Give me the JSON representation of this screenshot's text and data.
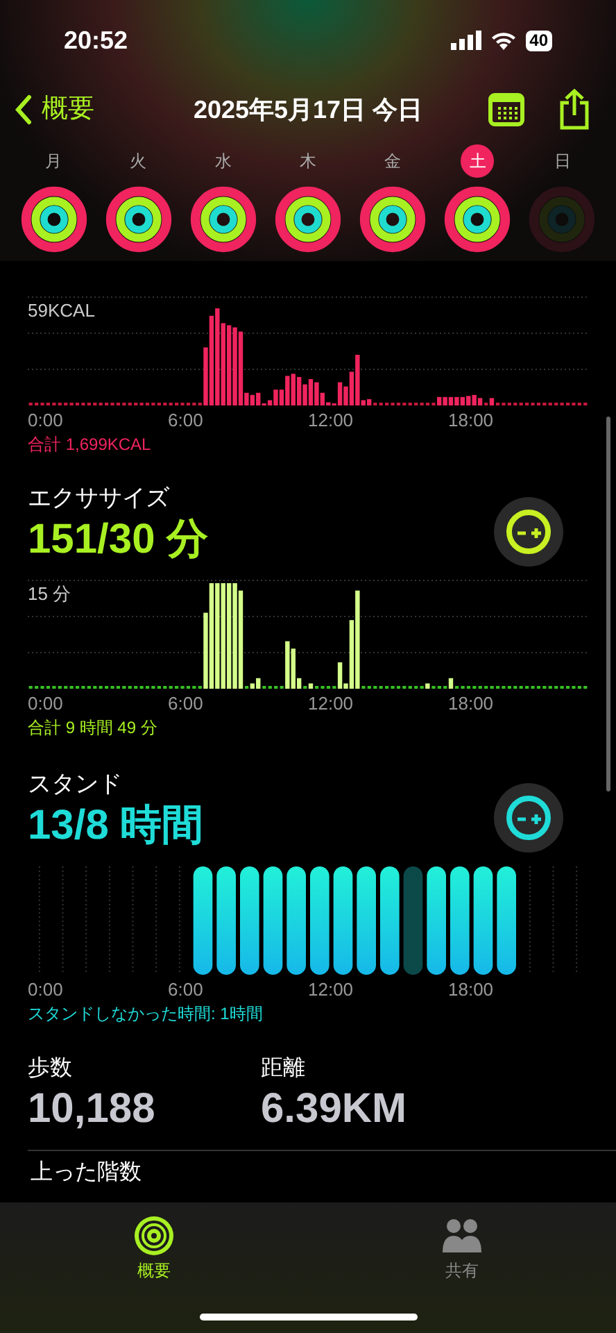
{
  "status_bar": {
    "time": "20:52",
    "battery": "40"
  },
  "nav": {
    "back": "概要",
    "title": "2025年5月17日 今日"
  },
  "week": [
    {
      "label": "月",
      "selected": false,
      "dimmed": false
    },
    {
      "label": "火",
      "selected": false,
      "dimmed": false
    },
    {
      "label": "水",
      "selected": false,
      "dimmed": false
    },
    {
      "label": "木",
      "selected": false,
      "dimmed": false
    },
    {
      "label": "金",
      "selected": false,
      "dimmed": false
    },
    {
      "label": "土",
      "selected": true,
      "dimmed": false
    },
    {
      "label": "日",
      "selected": false,
      "dimmed": true
    }
  ],
  "move": {
    "axis_top": "59KCAL",
    "xticks": [
      "0:00",
      "6:00",
      "12:00",
      "18:00"
    ],
    "total": "合計 1,699KCAL"
  },
  "exercise": {
    "title": "エクササイズ",
    "value": "151/30 分",
    "axis_top": "15 分",
    "xticks": [
      "0:00",
      "6:00",
      "12:00",
      "18:00"
    ],
    "total": "合計 9 時間 49 分"
  },
  "stand": {
    "title": "スタンド",
    "value": "13/8 時間",
    "xticks": [
      "0:00",
      "6:00",
      "12:00",
      "18:00"
    ],
    "total": "スタンドしなかった時間: 1時間"
  },
  "stats": [
    {
      "label": "歩数",
      "value": "10,188"
    },
    {
      "label": "距離",
      "value": "6.39KM"
    }
  ],
  "next_section": {
    "title": "上った階数"
  },
  "tab_bar": [
    {
      "label": "概要",
      "selected": true
    },
    {
      "label": "共有",
      "selected": false
    }
  ]
}
